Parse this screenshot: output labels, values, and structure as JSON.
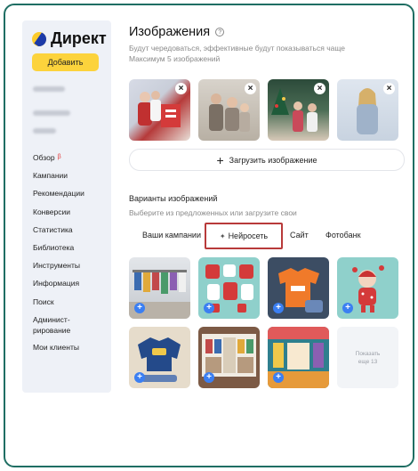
{
  "sidebar": {
    "logo_text": "Директ",
    "add_button": "Добавить",
    "nav": [
      {
        "label": "Обзор",
        "badge": "β"
      },
      {
        "label": "Кампании"
      },
      {
        "label": "Рекомендации"
      },
      {
        "label": "Конверсии"
      },
      {
        "label": "Статистика"
      },
      {
        "label": "Библиотека"
      },
      {
        "label": "Инструменты"
      },
      {
        "label": "Информация"
      },
      {
        "label": "Поиск"
      },
      {
        "label": "Админист­рирование"
      },
      {
        "label": "Мои клиенты"
      }
    ]
  },
  "main": {
    "title": "Изображения",
    "help_icon": "?",
    "subtitle_line1": "Будут чередоваться, эффективные будут показываться чаще",
    "subtitle_line2": "Максимум 5 изображений",
    "upload_label": "Загрузить изображение",
    "variants_title": "Варианты изображений",
    "variants_subtitle": "Выберите из предложенных или загрузите свои",
    "tabs": {
      "campaigns": "Ваши кампании",
      "neuro": "Нейросеть",
      "site": "Сайт",
      "photobank": "Фотобанк"
    },
    "more_line1": "Показать",
    "more_line2": "еще 13"
  },
  "colors": {
    "accent_yellow": "#fcd33c",
    "active_tab_border": "#b83a3a",
    "add_plus": "#3b7ff2",
    "frame_border": "#1f6e63"
  }
}
